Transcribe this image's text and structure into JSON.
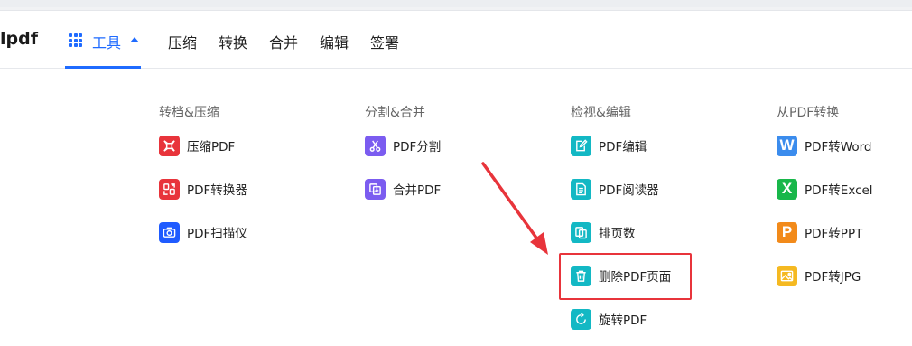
{
  "logo": {
    "text": "lpdf"
  },
  "nav": {
    "tools_label": "工具",
    "items": [
      "压缩",
      "转换",
      "合并",
      "编辑",
      "签署"
    ]
  },
  "columns": [
    {
      "title": "转档&压缩",
      "items": [
        {
          "label": "压缩PDF",
          "icon": "compress-icon",
          "color": "#e8343b"
        },
        {
          "label": "PDF转换器",
          "icon": "convert-icon",
          "color": "#e8343b"
        },
        {
          "label": "PDF扫描仪",
          "icon": "camera-icon",
          "color": "#1f5bff"
        }
      ]
    },
    {
      "title": "分割&合并",
      "items": [
        {
          "label": "PDF分割",
          "icon": "scissors-icon",
          "color": "#7b5cf0"
        },
        {
          "label": "合并PDF",
          "icon": "merge-icon",
          "color": "#7b5cf0"
        }
      ]
    },
    {
      "title": "检视&编辑",
      "items": [
        {
          "label": "PDF编辑",
          "icon": "edit-icon",
          "color": "#13b8c4"
        },
        {
          "label": "PDF阅读器",
          "icon": "reader-icon",
          "color": "#13b8c4"
        },
        {
          "label": "排页数",
          "icon": "page-number-icon",
          "color": "#13b8c4"
        },
        {
          "label": "删除PDF页面",
          "icon": "trash-icon",
          "color": "#13b8c4"
        },
        {
          "label": "旋转PDF",
          "icon": "rotate-icon",
          "color": "#13b8c4"
        }
      ]
    },
    {
      "title": "从PDF转换",
      "items": [
        {
          "label": "PDF转Word",
          "icon": "word-icon",
          "letter": "W",
          "color": "#3b8ced"
        },
        {
          "label": "PDF转Excel",
          "icon": "excel-icon",
          "letter": "X",
          "color": "#18b74a"
        },
        {
          "label": "PDF转PPT",
          "icon": "ppt-icon",
          "letter": "P",
          "color": "#f28a1a"
        },
        {
          "label": "PDF转JPG",
          "icon": "image-icon",
          "color": "#f5b921"
        }
      ]
    }
  ],
  "highlight": {
    "target": "删除PDF页面",
    "color": "#e8343b"
  }
}
